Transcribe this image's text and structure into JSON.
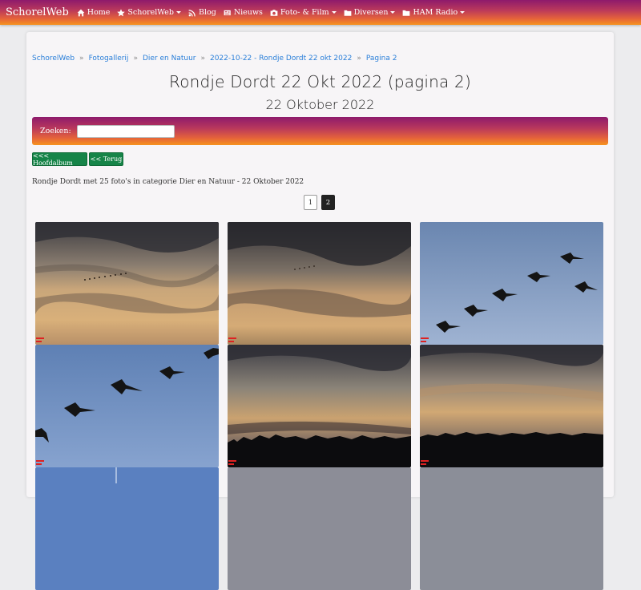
{
  "navbar": {
    "brand": "SchorelWeb",
    "items": [
      {
        "label": "Home",
        "icon": "home-icon",
        "dropdown": false
      },
      {
        "label": "SchorelWeb",
        "icon": "star-icon",
        "dropdown": true
      },
      {
        "label": "Blog",
        "icon": "rss-icon",
        "dropdown": false
      },
      {
        "label": "Nieuws",
        "icon": "newspaper-icon",
        "dropdown": false
      },
      {
        "label": "Foto- & Film",
        "icon": "camera-icon",
        "dropdown": true
      },
      {
        "label": "Diversen",
        "icon": "folder-icon",
        "dropdown": true
      },
      {
        "label": "HAM Radio",
        "icon": "folder-icon",
        "dropdown": true
      }
    ]
  },
  "breadcrumb": [
    "SchorelWeb",
    "Fotogallerij",
    "Dier en Natuur",
    "2022-10-22 - Rondje Dordt 22 okt 2022",
    "Pagina 2"
  ],
  "breadcrumb_separator": "»",
  "page": {
    "title": "Rondje Dordt 22 Okt 2022 (pagina 2)",
    "subtitle": "22 Oktober 2022"
  },
  "search": {
    "label": "Zoeken:",
    "value": ""
  },
  "buttons": {
    "main_album": "<<< Hoofdalbum",
    "back": "<< Terug"
  },
  "description": "Rondje Dordt met 25 foto's in categorie Dier en Natuur - 22 Oktober 2022",
  "pagination": {
    "pages": [
      "1",
      "2"
    ],
    "current": "2"
  },
  "colors": {
    "accent_gradient_start": "#8e1a6c",
    "accent_gradient_end": "#f6931e",
    "link": "#2a7fd9",
    "button_green": "#168448"
  },
  "photos": [
    {
      "scene": "sunset-clouds-geese-formation"
    },
    {
      "scene": "sunset-clouds-distant-geese"
    },
    {
      "scene": "blue-sky-geese-flock"
    },
    {
      "scene": "blue-sky-geese-close"
    },
    {
      "scene": "sunset-over-treeline"
    },
    {
      "scene": "sunset-over-treeline-wide"
    },
    {
      "scene": "blue-sky-partial"
    },
    {
      "scene": "sky-partial"
    },
    {
      "scene": "sky-partial"
    }
  ]
}
